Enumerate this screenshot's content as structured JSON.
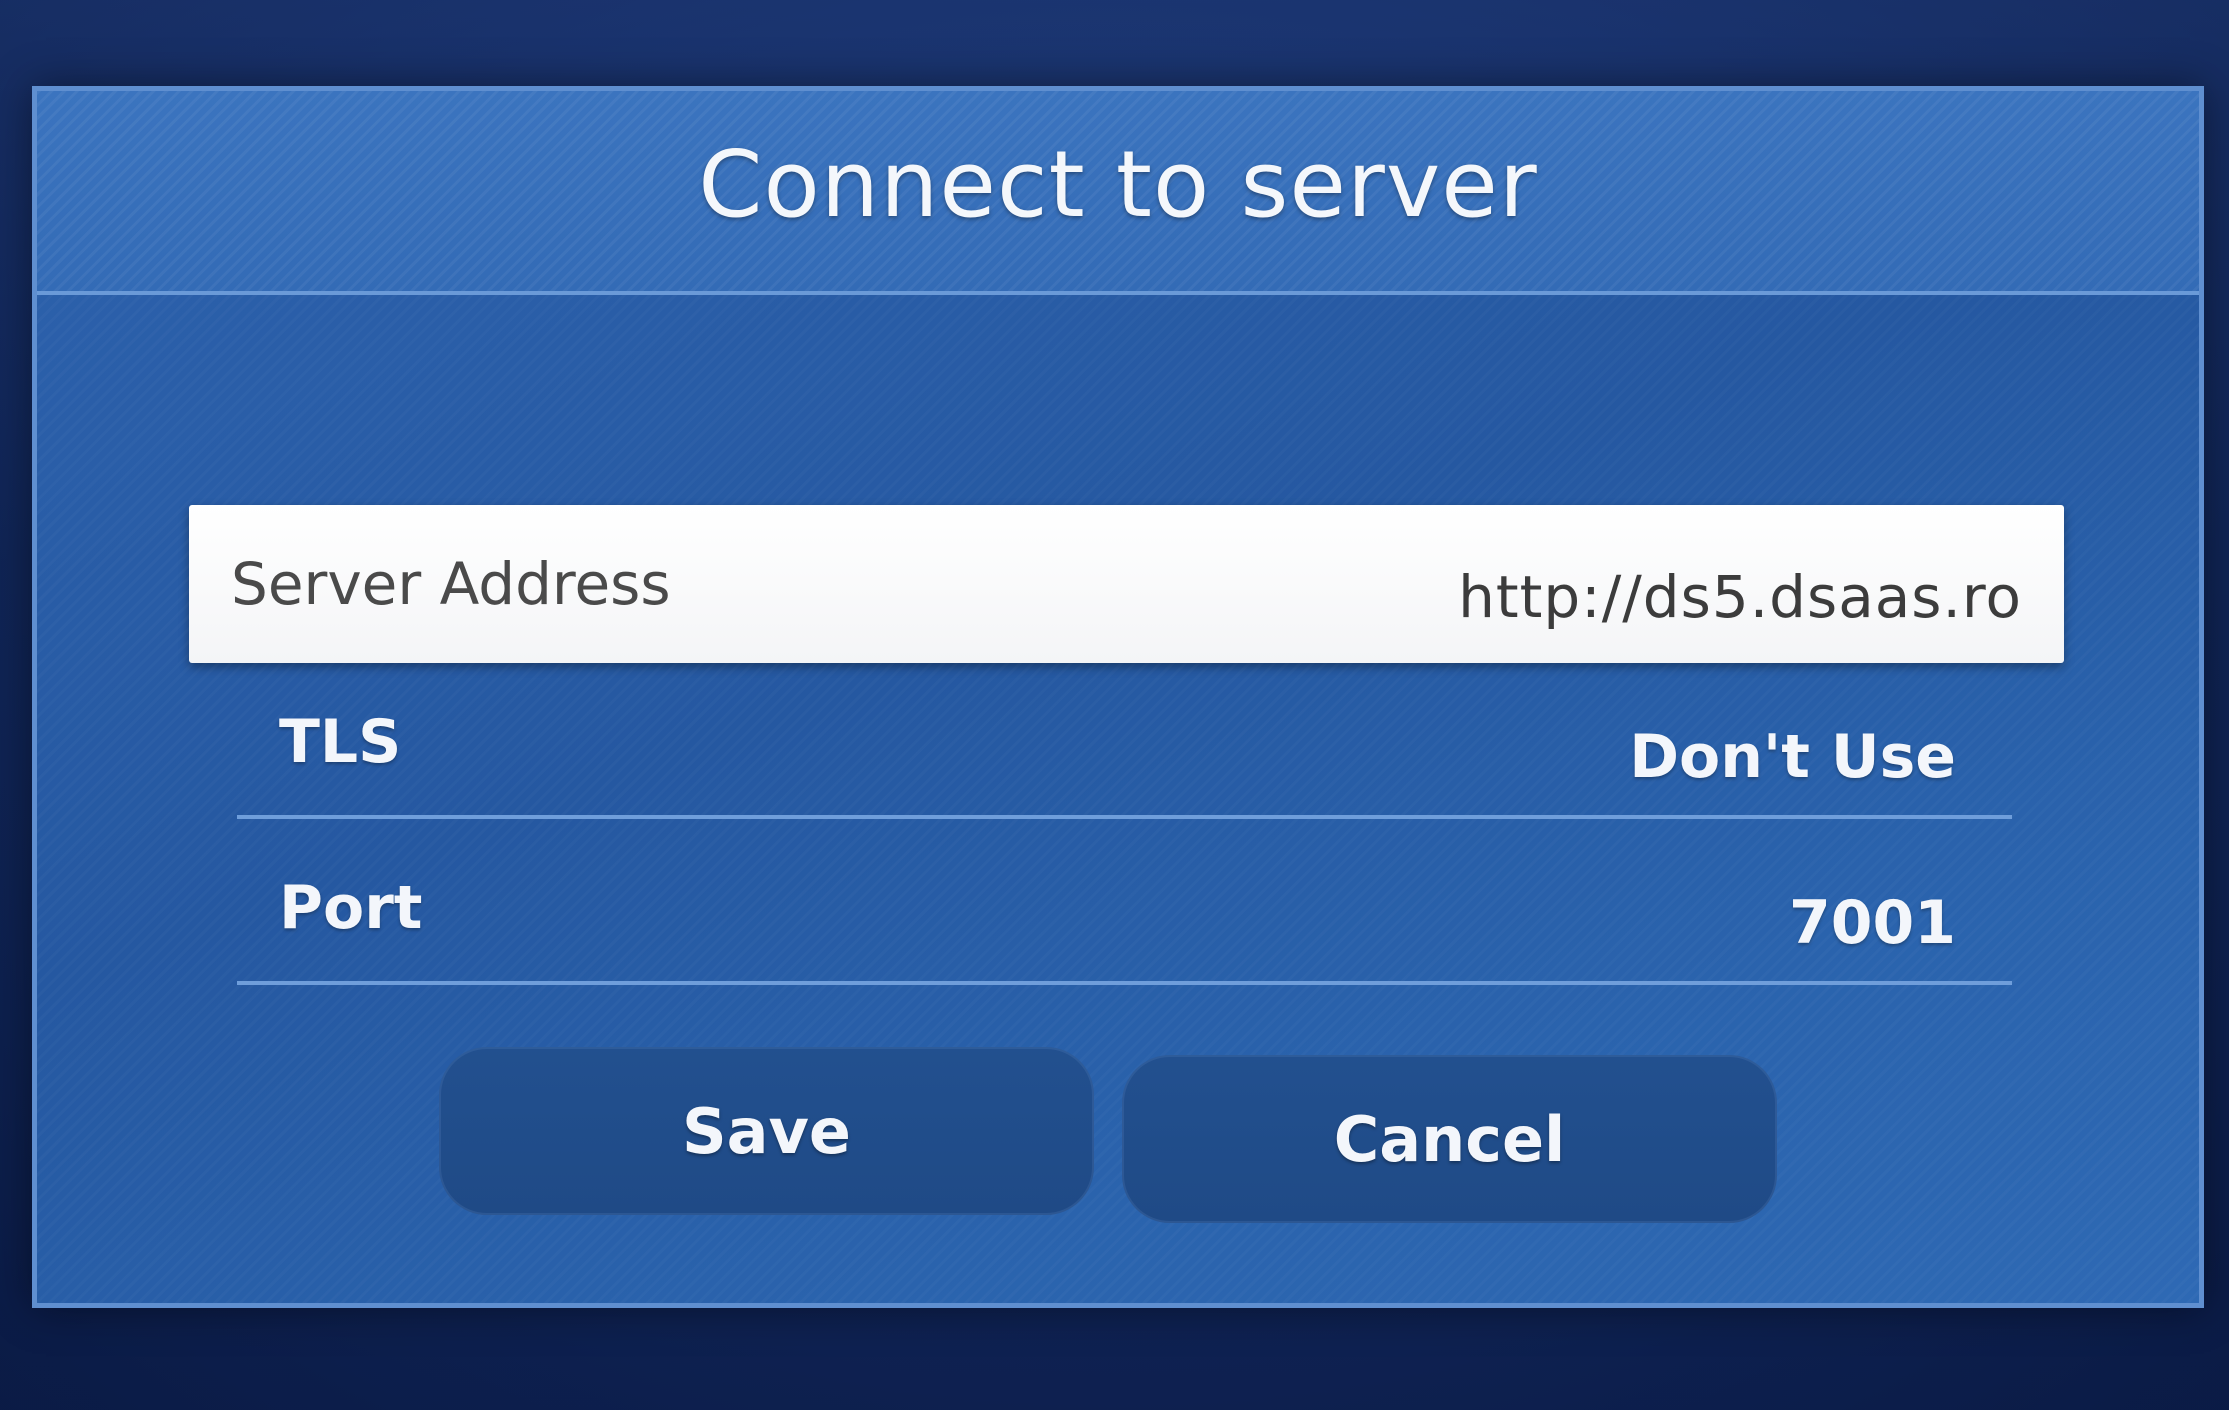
{
  "dialog": {
    "title": "Connect to server"
  },
  "fields": {
    "server_address": {
      "label": "Server Address",
      "value": "http://ds5.dsaas.ro"
    },
    "tls": {
      "label": "TLS",
      "value": "Don't Use"
    },
    "port": {
      "label": "Port",
      "value": "7001"
    }
  },
  "buttons": {
    "save_label": "Save",
    "cancel_label": "Cancel"
  },
  "colors": {
    "dialog_background": "#2a5ea8",
    "dialog_border": "#5f8fd0",
    "selected_field_background": "#ffffff",
    "button_background": "#21508c",
    "text_light": "#f3f6fb",
    "text_dark": "#3c3c3c"
  }
}
